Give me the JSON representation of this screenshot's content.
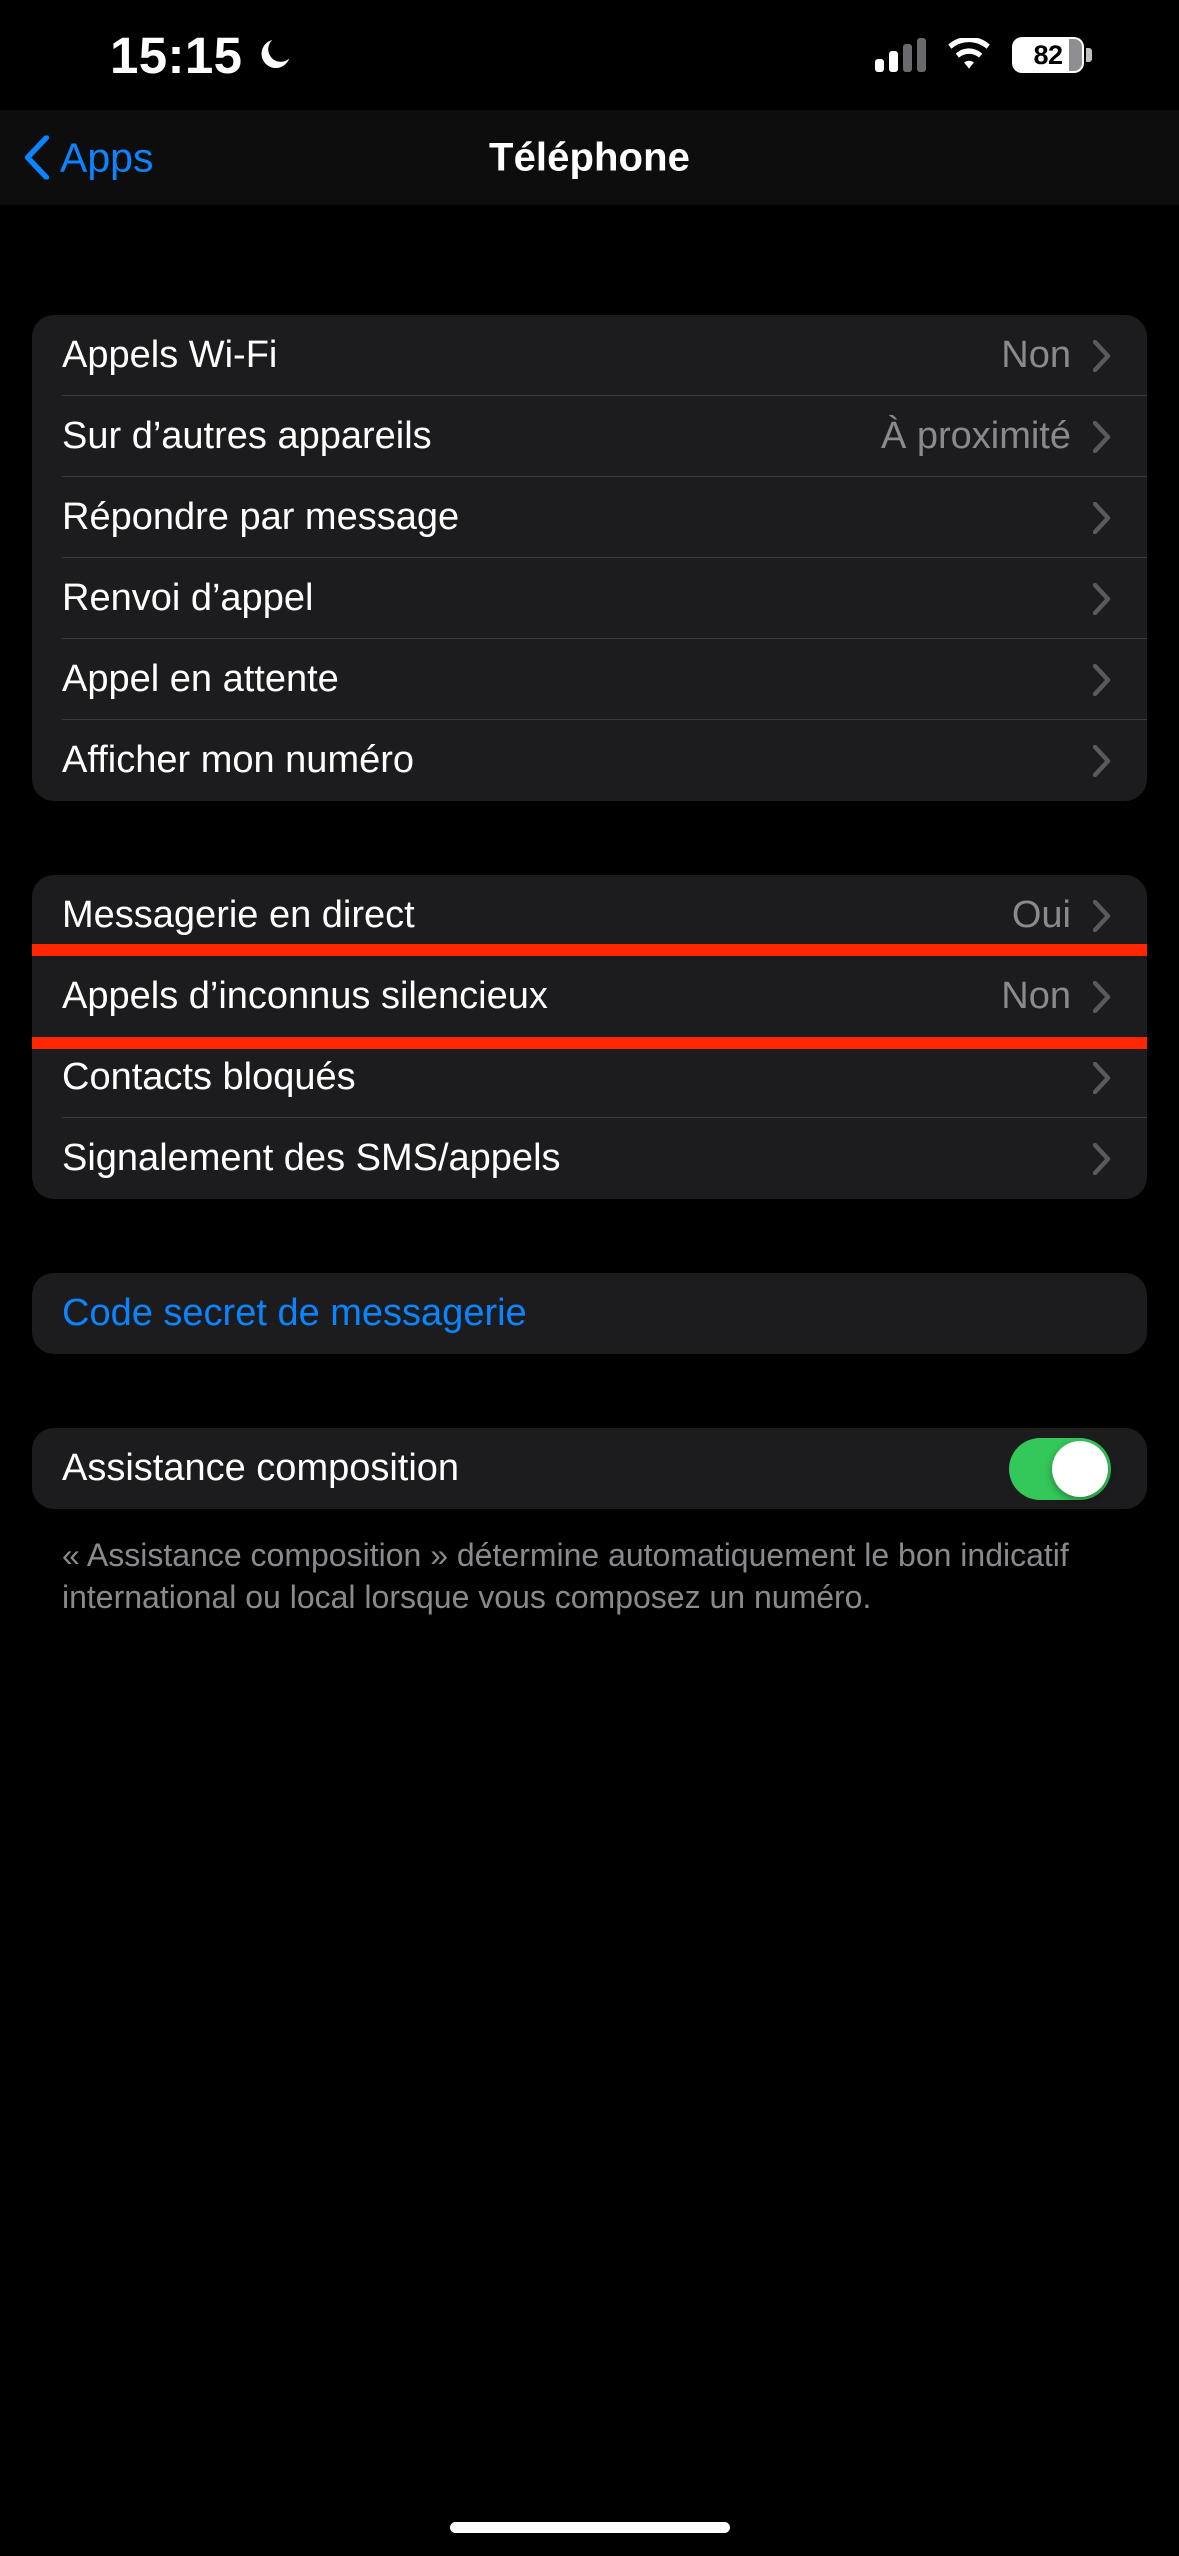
{
  "status_bar": {
    "time": "15:15",
    "moon_icon": "crescent-moon-icon",
    "cellular_icon": "cellular-signal-icon",
    "wifi_icon": "wifi-icon",
    "battery_level": "82"
  },
  "nav": {
    "back_label": "Apps",
    "back_icon": "chevron-left-icon",
    "title": "Téléphone"
  },
  "groups": [
    {
      "rows": [
        {
          "label": "Appels Wi-Fi",
          "value": "Non",
          "accessory": "chevron-right-icon"
        },
        {
          "label": "Sur d’autres appareils",
          "value": "À proximité",
          "accessory": "chevron-right-icon"
        },
        {
          "label": "Répondre par message",
          "value": "",
          "accessory": "chevron-right-icon"
        },
        {
          "label": "Renvoi d’appel",
          "value": "",
          "accessory": "chevron-right-icon"
        },
        {
          "label": "Appel en attente",
          "value": "",
          "accessory": "chevron-right-icon"
        },
        {
          "label": "Afficher mon numéro",
          "value": "",
          "accessory": "chevron-right-icon"
        }
      ]
    },
    {
      "rows": [
        {
          "label": "Messagerie en direct",
          "value": "Oui",
          "accessory": "chevron-right-icon"
        },
        {
          "label": "Appels d’inconnus silencieux",
          "value": "Non",
          "accessory": "chevron-right-icon",
          "highlighted": true
        },
        {
          "label": "Contacts bloqués",
          "value": "",
          "accessory": "chevron-right-icon"
        },
        {
          "label": "Signalement des SMS/appels",
          "value": "",
          "accessory": "chevron-right-icon"
        }
      ]
    },
    {
      "rows": [
        {
          "label": "Code secret de messagerie",
          "value": "",
          "accessory": "none",
          "style": "link"
        }
      ]
    },
    {
      "rows": [
        {
          "label": "Assistance composition",
          "value": "",
          "accessory": "toggle",
          "toggle_on": true
        }
      ]
    }
  ],
  "footer_text": "« Assistance composition » détermine automatiquement le bon indicatif international ou local lorsque vous composez un numéro.",
  "colors": {
    "accent_blue": "#0A84FF",
    "toggle_green": "#34C759",
    "highlight_red": "#FF2600",
    "card_bg": "#1C1C1E",
    "page_bg": "#000000",
    "secondary_text": "#8A8A8E"
  }
}
